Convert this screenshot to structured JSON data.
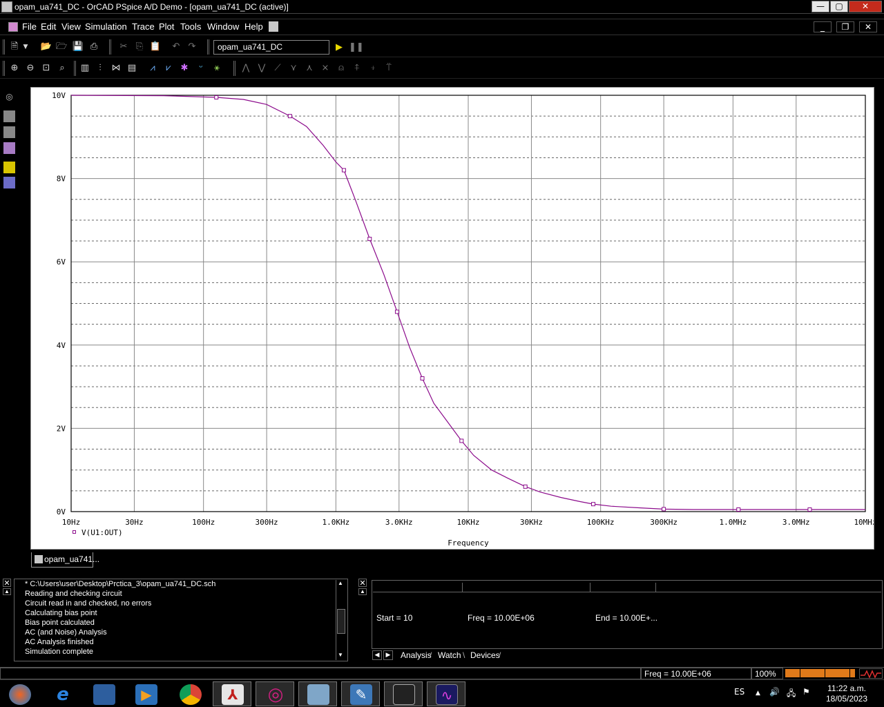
{
  "window": {
    "title": "opam_ua741_DC - OrCAD PSpice A/D Demo  - [opam_ua741_DC (active)]",
    "minimize_glyph": "—",
    "maximize_glyph": "▢",
    "close_glyph": "✕"
  },
  "menu": {
    "items": [
      "File",
      "Edit",
      "View",
      "Simulation",
      "Trace",
      "Plot",
      "Tools",
      "Window",
      "Help"
    ],
    "mdi_minimize": "_",
    "mdi_restore": "❐",
    "mdi_close": "✕"
  },
  "toolbar": {
    "profile_value": "opam_ua741_DC",
    "icons1": [
      "new-icon",
      "dropdown-icon",
      "open-icon",
      "open-folder-icon",
      "save-icon",
      "print-icon",
      "cut-icon",
      "copy-icon",
      "paste-icon",
      "undo-icon",
      "redo-icon",
      "run-icon",
      "pause-icon"
    ],
    "icons2": [
      "zoom-in-icon",
      "zoom-out-icon",
      "zoom-area-icon",
      "zoom-fit-icon",
      "log-x-icon",
      "fourier-icon",
      "performance-icon",
      "eval-icon",
      "add-trace-icon",
      "trace-expr-icon",
      "plot-digital-icon",
      "mark-data-icon",
      "cursor-icon",
      "cursor-peak-icon",
      "cursor-trough-icon",
      "cursor-slope-icon",
      "cursor-min-icon",
      "cursor-max-icon",
      "cursor-point-icon",
      "cursor-search-icon",
      "cursor-next-icon",
      "cursor-label-icon"
    ]
  },
  "plot": {
    "colors": {
      "background": "#ffffff",
      "trace": "#8b0a8b",
      "grid": "#000000"
    },
    "xlabel": "Frequency",
    "legend": "V(U1:OUT)",
    "tab_label": "opam_ua741..."
  },
  "chart_data": {
    "type": "line",
    "x_scale": "log",
    "xlim": [
      10,
      10000000
    ],
    "ylim": [
      0,
      10
    ],
    "x_ticks": [
      10,
      30,
      100,
      300,
      1000,
      3000,
      10000,
      30000,
      100000,
      300000,
      1000000,
      3000000,
      10000000
    ],
    "x_tick_labels": [
      "10Hz",
      "30Hz",
      "100Hz",
      "300Hz",
      "1.0KHz",
      "3.0KHz",
      "10KHz",
      "30KHz",
      "100KHz",
      "300KHz",
      "1.0MHz",
      "3.0MHz",
      "10MHz"
    ],
    "y_ticks": [
      0,
      2,
      4,
      6,
      8,
      10
    ],
    "y_tick_labels": [
      "0V",
      "2V",
      "4V",
      "6V",
      "8V",
      "10V"
    ],
    "xlabel": "Frequency",
    "grid": true,
    "series": [
      {
        "name": "V(U1:OUT)",
        "color": "#8b0a8b",
        "x": [
          10,
          50,
          125,
          200,
          300,
          450,
          600,
          800,
          1000,
          1150,
          1400,
          1800,
          2300,
          2900,
          3600,
          4500,
          5500,
          7000,
          8900,
          11000,
          15000,
          20000,
          27000,
          35000,
          50000,
          70000,
          88000,
          120000,
          200000,
          300000,
          500000,
          1000000,
          2000000,
          3800000,
          10000000
        ],
        "y": [
          10.0,
          9.99,
          9.95,
          9.9,
          9.78,
          9.5,
          9.25,
          8.8,
          8.4,
          8.2,
          7.5,
          6.55,
          5.7,
          4.8,
          3.95,
          3.2,
          2.6,
          2.15,
          1.7,
          1.35,
          1.0,
          0.8,
          0.6,
          0.47,
          0.34,
          0.24,
          0.18,
          0.13,
          0.09,
          0.06,
          0.05,
          0.05,
          0.05,
          0.05,
          0.05
        ]
      }
    ],
    "markers_x": [
      125,
      450,
      1150,
      1800,
      2900,
      4500,
      8900,
      27000,
      88000,
      300000,
      1100000,
      3800000
    ]
  },
  "output": {
    "lines": [
      "* C:\\Users\\user\\Desktop\\Prctica_3\\opam_ua741_DC.sch",
      "Reading and checking circuit",
      "Circuit read in and checked, no errors",
      "Calculating bias point",
      "Bias point calculated",
      "AC (and Noise) Analysis",
      "AC Analysis finished",
      "Simulation complete"
    ]
  },
  "status_panel": {
    "start": "Start =  10",
    "freq": "Freq =  10.00E+06",
    "end": "End =  10.00E+...",
    "tabs": [
      "Analysis",
      "Watch",
      "Devices"
    ]
  },
  "statusbar": {
    "freq": "Freq =  10.00E+06",
    "percent": "100%",
    "progress": 1.0
  },
  "taskbar": {
    "apps": [
      "start-orb-icon",
      "internet-explorer-icon",
      "file-explorer-icon",
      "media-player-icon",
      "chrome-icon",
      "acrobat-icon",
      "orcad-capture-icon",
      "schematics-icon",
      "pspice-model-icon",
      "pspice-ad-icon",
      "pspice-probe-icon"
    ],
    "language": "ES",
    "time": "11:22 a.m.",
    "date": "18/05/2023"
  }
}
